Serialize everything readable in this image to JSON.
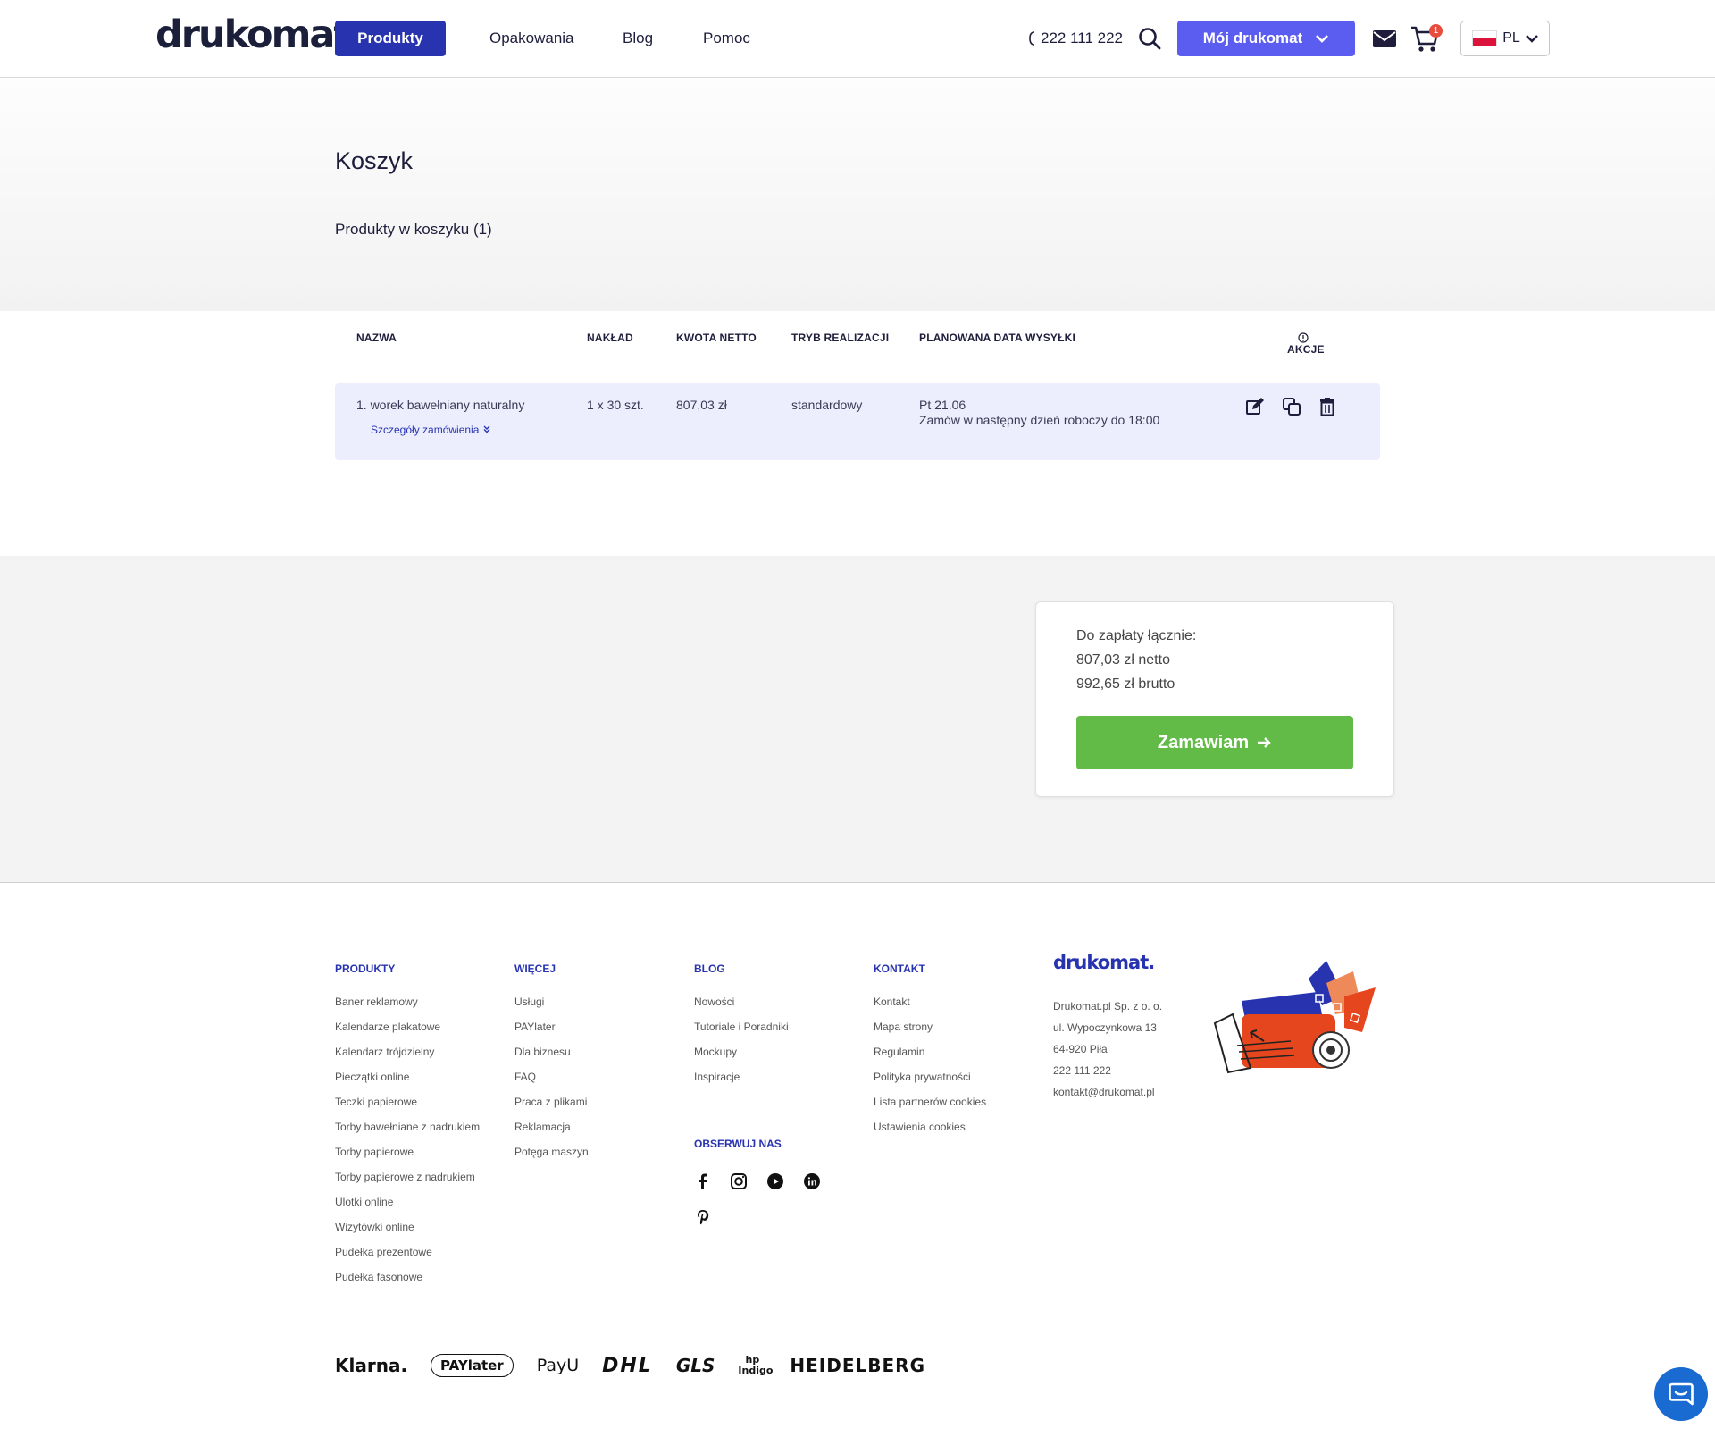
{
  "header": {
    "logo": "drukomat",
    "logo_dot": ".",
    "nav": [
      "Produkty",
      "Opakowania",
      "Blog",
      "Pomoc"
    ],
    "phone": "222 111 222",
    "account_button": "Mój drukomat",
    "cart_count": "1",
    "language": "PL"
  },
  "page": {
    "title": "Koszyk",
    "subtitle": "Produkty w koszyku (1)"
  },
  "table": {
    "headers": [
      "NAZWA",
      "NAKŁAD",
      "KWOTA NETTO",
      "TRYB REALIZACJI",
      "PLANOWANA DATA WYSYŁKI",
      "AKCJE"
    ],
    "rows": [
      {
        "name": "1. worek bawełniany naturalny",
        "details": "Szczegóły zamówienia",
        "quantity": "1 x 30 szt.",
        "net": "807,03 zł",
        "mode": "standardowy",
        "date": "Pt 21.06",
        "date_note": "Zamów w następny dzień roboczy do 18:00"
      }
    ]
  },
  "summary": {
    "label": "Do zapłaty łącznie:",
    "net": "807,03 zł netto",
    "gross": "992,65 zł brutto",
    "order_button": "Zamawiam"
  },
  "footer": {
    "produkty": {
      "title": "PRODUKTY",
      "items": [
        "Baner reklamowy",
        "Kalendarze plakatowe",
        "Kalendarz trójdzielny",
        "Pieczątki online",
        "Teczki papierowe",
        "Torby bawełniane z nadrukiem",
        "Torby papierowe",
        "Torby papierowe z nadrukiem",
        "Ulotki online",
        "Wizytówki online",
        "Pudełka prezentowe",
        "Pudełka fasonowe"
      ]
    },
    "wiecej": {
      "title": "WIĘCEJ",
      "items": [
        "Usługi",
        "PAYlater",
        "Dla biznesu",
        "FAQ",
        "Praca z plikami",
        "Reklamacja",
        "Potęga maszyn"
      ]
    },
    "blog": {
      "title": "BLOG",
      "items": [
        "Nowości",
        "Tutoriale i Poradniki",
        "Mockupy",
        "Inspiracje"
      ]
    },
    "follow_title": "OBSERWUJ NAS",
    "kontakt": {
      "title": "KONTAKT",
      "items": [
        "Kontakt",
        "Mapa strony",
        "Regulamin",
        "Polityka prywatności",
        "Lista partnerów cookies",
        "Ustawienia cookies"
      ]
    },
    "company": {
      "logo": "drukomat.",
      "lines": [
        "Drukomat.pl Sp. z o. o.",
        "ul. Wypoczynkowa 13",
        "64-920 Piła",
        "222 111 222",
        "kontakt@drukomat.pl"
      ]
    },
    "partners": [
      "Klarna.",
      "PAYlater",
      "PayU",
      "DHL",
      "GLS",
      "hp Indigo",
      "HEIDELBERG"
    ]
  },
  "colors": {
    "primary": "#2833b0",
    "accent": "#5b5cf0",
    "order": "#62bb47",
    "row_bg": "#eceefd"
  }
}
